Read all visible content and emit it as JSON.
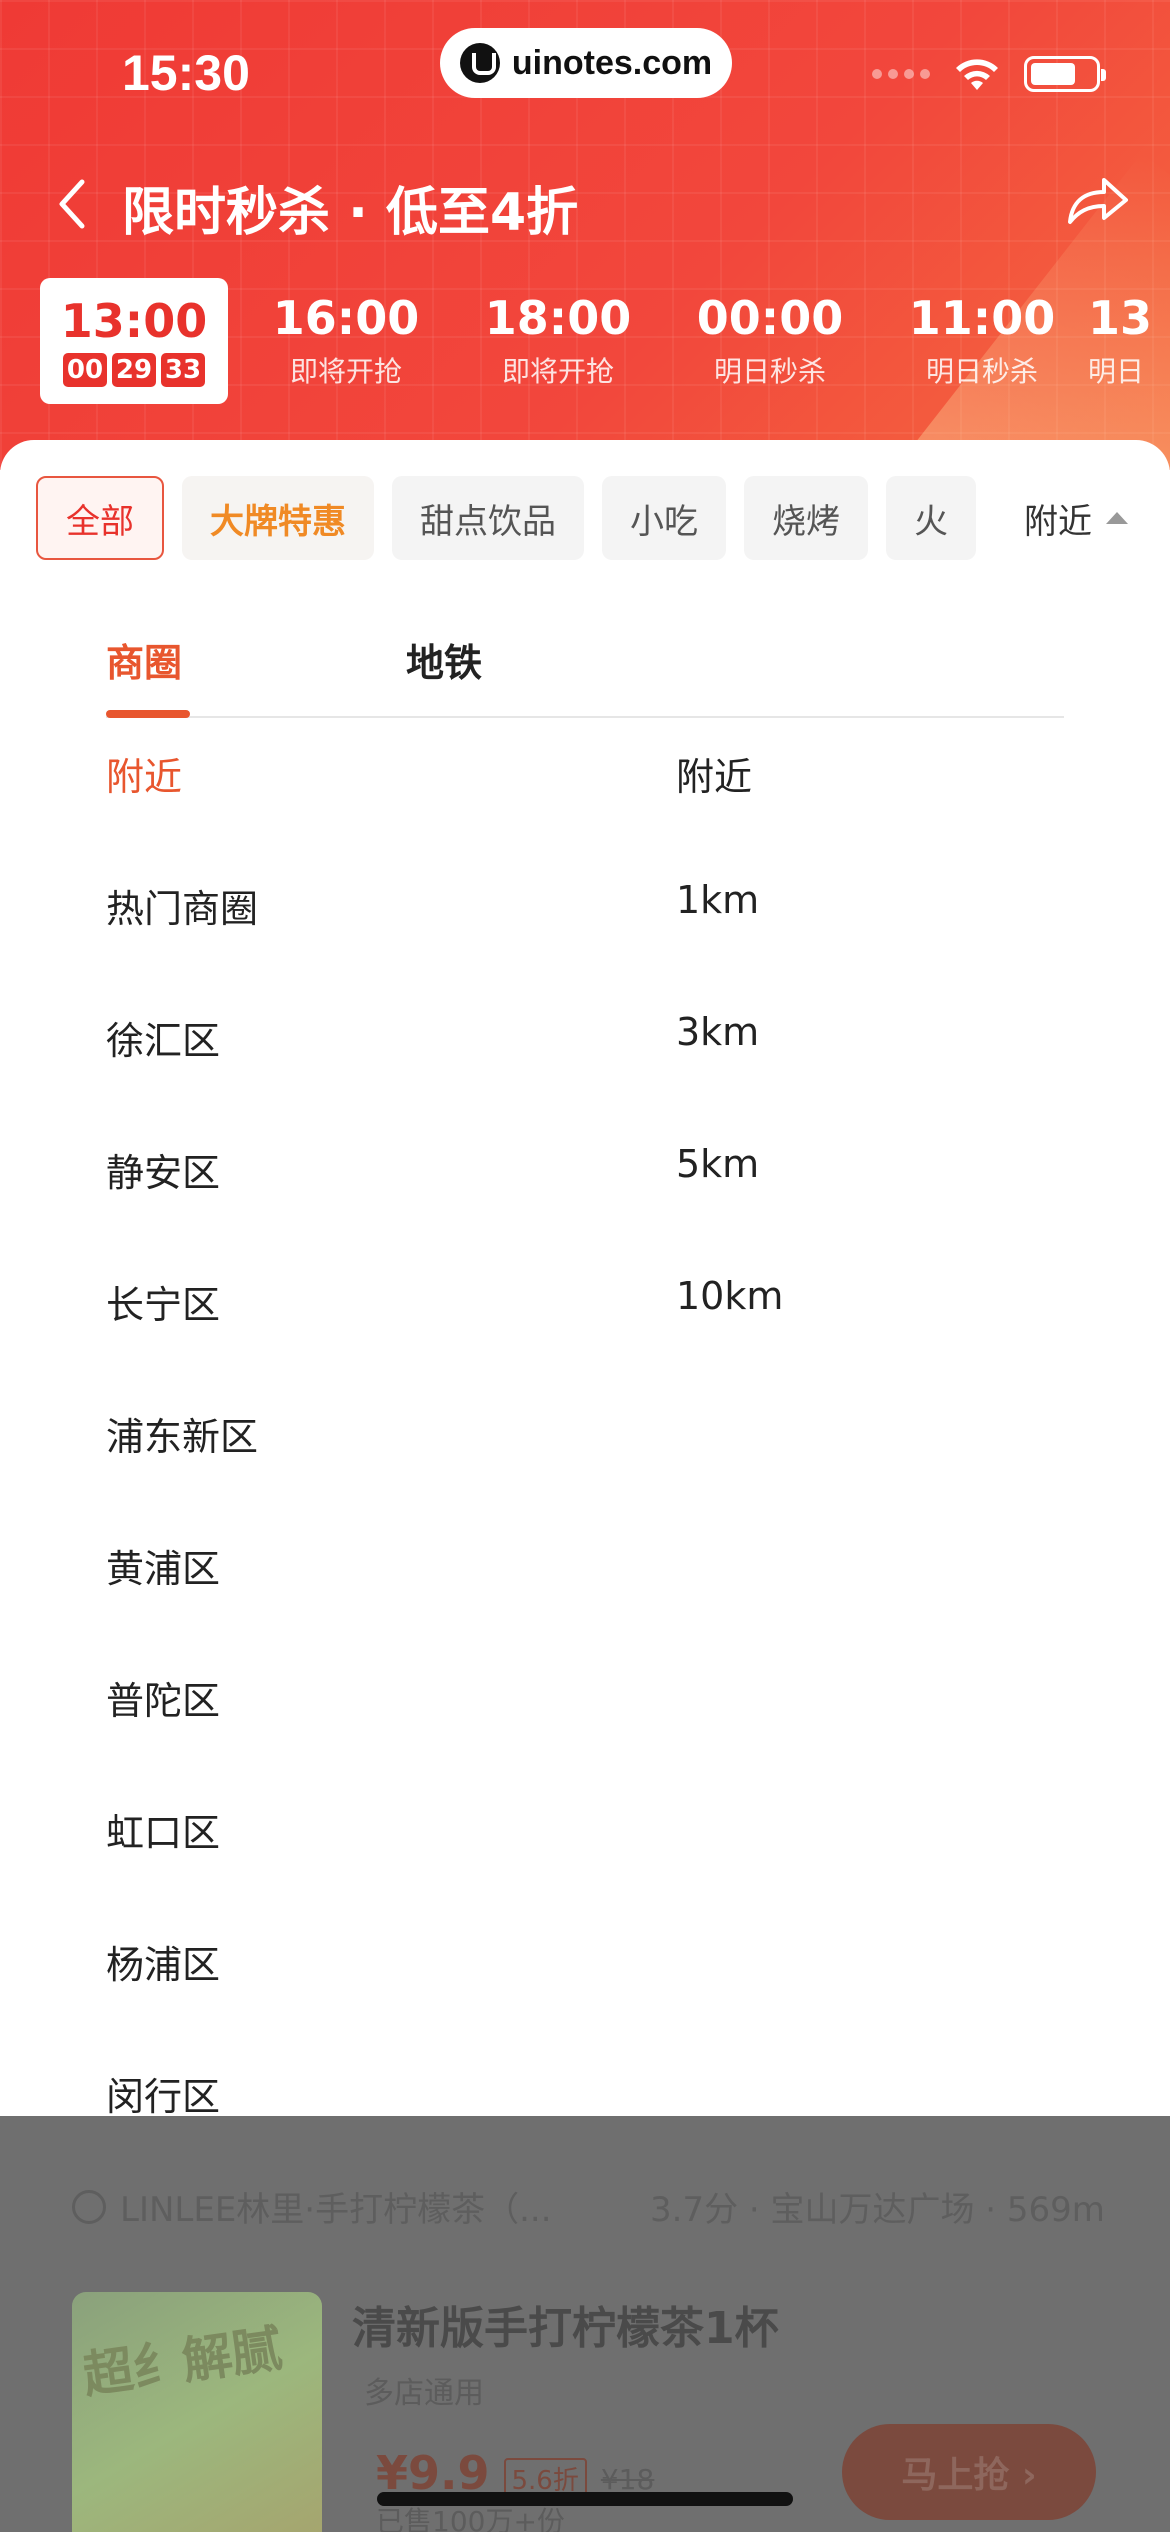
{
  "status_bar": {
    "time": "15:30",
    "url": "uinotes.com"
  },
  "nav": {
    "title": "限时秒杀 · 低至4折"
  },
  "time_slots": [
    {
      "time": "13:00",
      "countdown": [
        "00",
        "29",
        "33"
      ],
      "active": true
    },
    {
      "time": "16:00",
      "status": "即将开抢"
    },
    {
      "time": "18:00",
      "status": "即将开抢"
    },
    {
      "time": "00:00",
      "status": "明日秒杀"
    },
    {
      "time": "11:00",
      "status": "明日秒杀"
    },
    {
      "time": "13",
      "status": "明日"
    }
  ],
  "filter_chips": [
    "全部",
    "大牌特惠",
    "甜点饮品",
    "小吃",
    "烧烤",
    "火"
  ],
  "nearby_select": {
    "label": "附近"
  },
  "tabs": [
    "商圈",
    "地铁"
  ],
  "districts": [
    "附近",
    "热门商圈",
    "徐汇区",
    "静安区",
    "长宁区",
    "浦东新区",
    "黄浦区",
    "普陀区",
    "虹口区",
    "杨浦区",
    "闵行区"
  ],
  "distances": [
    "附近",
    "1km",
    "3km",
    "5km",
    "10km"
  ],
  "background_card": {
    "shop_name": "LINLEE林里·手打柠檬茶（...",
    "shop_meta": "3.7分 · 宝山万达广场 · 569m",
    "image_text": "超纟解腻",
    "product_title": "清新版手打柠檬茶1杯",
    "product_sub": "多店通用",
    "price": "¥9.9",
    "discount": "5.6折",
    "original_price": "¥18",
    "sold": "已售100万+份",
    "button": "马上抢 ›"
  }
}
